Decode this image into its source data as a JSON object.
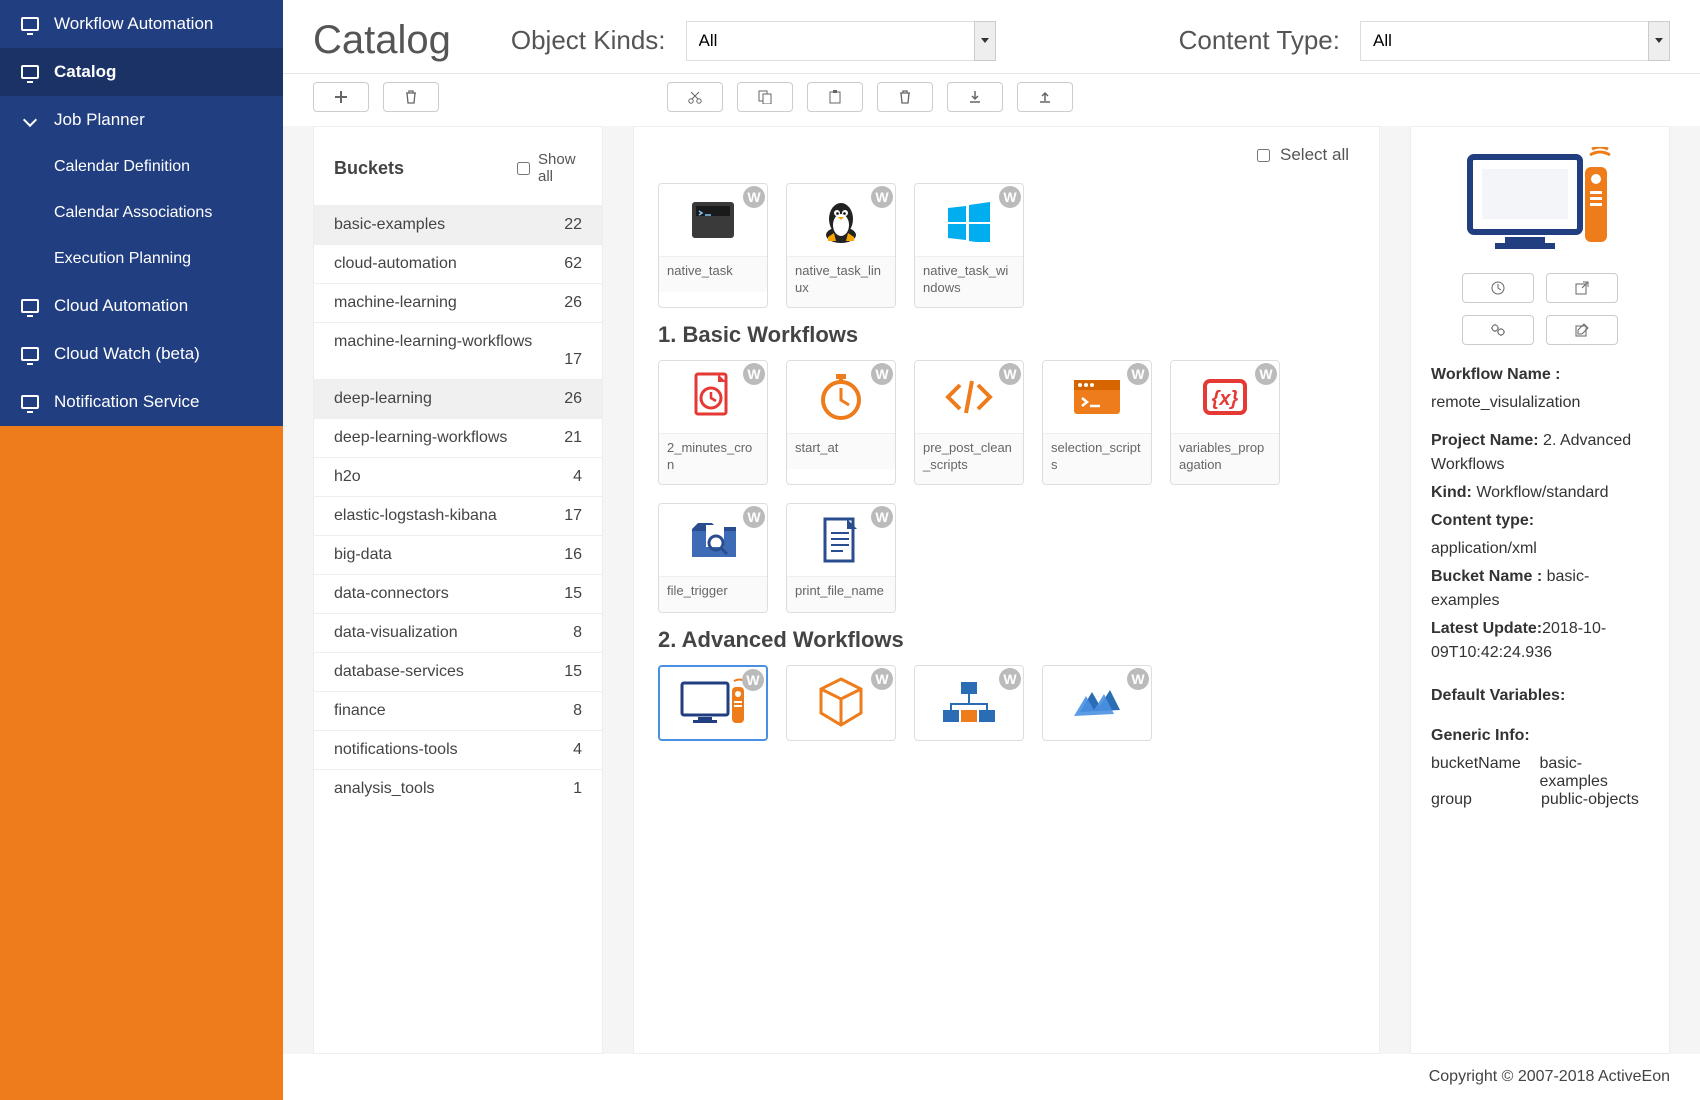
{
  "sidebar": {
    "items": [
      {
        "label": "Workflow Automation",
        "icon": "monitor",
        "kind": "link"
      },
      {
        "label": "Catalog",
        "icon": "monitor",
        "kind": "link",
        "active": true
      },
      {
        "label": "Job Planner",
        "icon": "chev",
        "kind": "header"
      },
      {
        "label": "Calendar Definition",
        "kind": "sub"
      },
      {
        "label": "Calendar Associations",
        "kind": "sub"
      },
      {
        "label": "Execution Planning",
        "kind": "sub"
      },
      {
        "label": "Cloud Automation",
        "icon": "monitor",
        "kind": "link"
      },
      {
        "label": "Cloud Watch (beta)",
        "icon": "monitor",
        "kind": "link"
      },
      {
        "label": "Notification Service",
        "icon": "monitor",
        "kind": "link"
      }
    ]
  },
  "header": {
    "title": "Catalog",
    "filters": {
      "object_kinds_label": "Object Kinds:",
      "object_kinds_value": "All",
      "content_type_label": "Content Type:",
      "content_type_value": "All"
    }
  },
  "buckets": {
    "title": "Buckets",
    "showall_label": "Show all",
    "items": [
      {
        "name": "basic-examples",
        "count": 22,
        "selected": true
      },
      {
        "name": "cloud-automation",
        "count": 62
      },
      {
        "name": "machine-learning",
        "count": 26
      },
      {
        "name": "machine-learning-workflows",
        "count": 17,
        "wrap": true
      },
      {
        "name": "deep-learning",
        "count": 26,
        "selected": true
      },
      {
        "name": "deep-learning-workflows",
        "count": 21
      },
      {
        "name": "h2o",
        "count": 4
      },
      {
        "name": "elastic-logstash-kibana",
        "count": 17
      },
      {
        "name": "big-data",
        "count": 16
      },
      {
        "name": "data-connectors",
        "count": 15
      },
      {
        "name": "data-visualization",
        "count": 8
      },
      {
        "name": "database-services",
        "count": 15
      },
      {
        "name": "finance",
        "count": 8
      },
      {
        "name": "notifications-tools",
        "count": 4
      },
      {
        "name": "analysis_tools",
        "count": 1
      }
    ]
  },
  "items_panel": {
    "selectall_label": "Select all",
    "sections": [
      {
        "title": "",
        "cards": [
          {
            "label": "native_task",
            "icon": "terminal"
          },
          {
            "label": "native_task_linux",
            "icon": "linux"
          },
          {
            "label": "native_task_windows",
            "icon": "windows"
          }
        ]
      },
      {
        "title": "1. Basic Workflows",
        "cards": [
          {
            "label": "2_minutes_cron",
            "icon": "clock-doc"
          },
          {
            "label": "start_at",
            "icon": "stopwatch"
          },
          {
            "label": "pre_post_clean_scripts",
            "icon": "code"
          },
          {
            "label": "selection_scripts",
            "icon": "shell-window"
          },
          {
            "label": "variables_propagation",
            "icon": "var-x"
          },
          {
            "label": "file_trigger",
            "icon": "file-search"
          },
          {
            "label": "print_file_name",
            "icon": "doc-lines"
          }
        ]
      },
      {
        "title": "2. Advanced Workflows",
        "cards": [
          {
            "label": "",
            "icon": "remote-vis",
            "selected": true
          },
          {
            "label": "",
            "icon": "cube"
          },
          {
            "label": "",
            "icon": "network"
          },
          {
            "label": "",
            "icon": "mpi"
          }
        ]
      }
    ]
  },
  "details": {
    "workflow_name_label": "Workflow Name :",
    "workflow_name_value": "remote_visulalization",
    "project_name_label": "Project Name:",
    "project_name_value": "2. Advanced Workflows",
    "kind_label": "Kind:",
    "kind_value": "Workflow/standard",
    "content_type_label": "Content type:",
    "content_type_value": "application/xml",
    "bucket_name_label": "Bucket Name :",
    "bucket_name_value": "basic-examples",
    "latest_update_label": "Latest Update:",
    "latest_update_value": "2018-10-09T10:42:24.936",
    "default_variables_label": "Default Variables:",
    "generic_info_label": "Generic Info:",
    "generic_info": [
      {
        "key": "bucketName",
        "value": "basic-examples"
      },
      {
        "key": "group",
        "value": "public-objects"
      }
    ]
  },
  "footer": {
    "text": "Copyright © 2007-2018 ActiveEon"
  }
}
